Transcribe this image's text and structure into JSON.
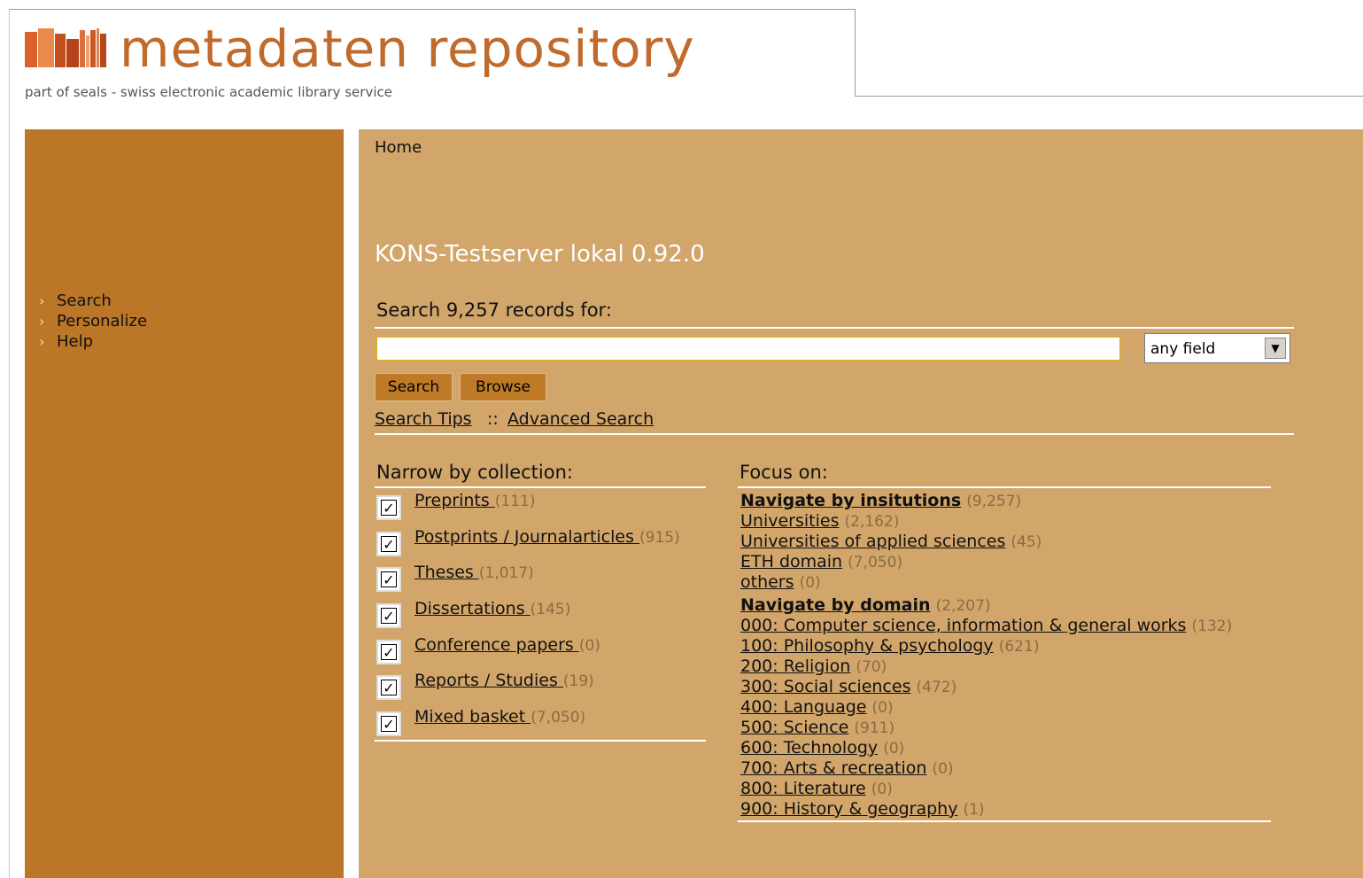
{
  "header": {
    "title": "metadaten repository",
    "subtitle": "part of seals - swiss electronic academic library service"
  },
  "sidebar": {
    "items": [
      {
        "label": "Search"
      },
      {
        "label": "Personalize"
      },
      {
        "label": "Help"
      }
    ]
  },
  "main": {
    "breadcrumb": "Home",
    "server_title": "KONS-Testserver lokal 0.92.0",
    "search_label": "Search 9,257 records for:",
    "search_input": {
      "value": "",
      "placeholder": ""
    },
    "field_select": {
      "value": "any field"
    },
    "buttons": {
      "search": "Search",
      "browse": "Browse"
    },
    "links": {
      "search_tips": "Search Tips",
      "separator": "::",
      "advanced_search": "Advanced Search"
    }
  },
  "collections": {
    "heading": "Narrow by collection:",
    "items": [
      {
        "label": "Preprints",
        "count": "(111)",
        "checked": true
      },
      {
        "label": "Postprints / Journalarticles",
        "count": "(915)",
        "checked": true
      },
      {
        "label": "Theses",
        "count": "(1,017)",
        "checked": true
      },
      {
        "label": "Dissertations",
        "count": "(145)",
        "checked": true
      },
      {
        "label": "Conference papers",
        "count": "(0)",
        "checked": true
      },
      {
        "label": "Reports / Studies",
        "count": "(19)",
        "checked": true
      },
      {
        "label": "Mixed basket",
        "count": "(7,050)",
        "checked": true
      }
    ]
  },
  "focus": {
    "heading": "Focus on:",
    "institutions": {
      "label": "Navigate by insitutions",
      "count": "(9,257)",
      "items": [
        {
          "label": "Universities",
          "count": "(2,162)"
        },
        {
          "label": "Universities of applied sciences",
          "count": "(45)"
        },
        {
          "label": "ETH domain",
          "count": "(7,050)"
        },
        {
          "label": "others",
          "count": "(0)"
        }
      ]
    },
    "domains": {
      "label": "Navigate by domain",
      "count": "(2,207)",
      "items": [
        {
          "label": "000: Computer science, information & general works",
          "count": "(132)"
        },
        {
          "label": "100: Philosophy & psychology",
          "count": "(621)"
        },
        {
          "label": "200: Religion",
          "count": "(70)"
        },
        {
          "label": "300: Social sciences",
          "count": "(472)"
        },
        {
          "label": "400: Language",
          "count": "(0)"
        },
        {
          "label": "500: Science",
          "count": "(911)"
        },
        {
          "label": "600: Technology",
          "count": "(0)"
        },
        {
          "label": "700: Arts & recreation",
          "count": "(0)"
        },
        {
          "label": "800: Literature",
          "count": "(0)"
        },
        {
          "label": "900: History & geography",
          "count": "(1)"
        }
      ]
    }
  },
  "colors": {
    "sidebar": "#bb7628",
    "main": "#d2a66b",
    "title": "#c06a2c",
    "count": "#8a6b44"
  }
}
